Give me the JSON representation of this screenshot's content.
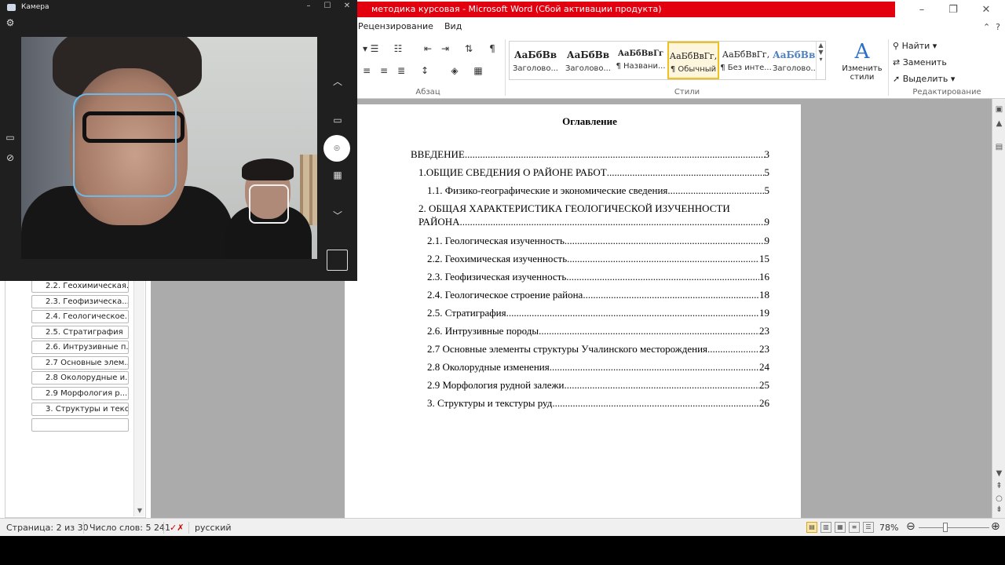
{
  "word": {
    "title": "методика курсовая  -  Microsoft Word (Сбой активации продукта)",
    "window_controls": [
      "–",
      "❐",
      "✕"
    ],
    "ribbon_tabs": [
      "Рецензирование",
      "Вид"
    ],
    "groups": {
      "paragraph": "Абзац",
      "styles": "Стили",
      "editing": "Редактирование"
    },
    "styles": [
      {
        "preview": "АаБбВв",
        "name": "Заголово..."
      },
      {
        "preview": "АаБбВв",
        "name": "Заголово..."
      },
      {
        "preview": "АаБбВвГг",
        "name": "¶ Названи..."
      },
      {
        "preview": "АаБбВвГг,",
        "name": "¶ Обычный"
      },
      {
        "preview": "АаБбВвГг,",
        "name": "¶ Без инте..."
      },
      {
        "preview": "АаБбВвI",
        "name": "Заголово..."
      }
    ],
    "change_styles": "Изменить стили",
    "editing": {
      "find": "Найти",
      "replace": "Заменить",
      "select": "Выделить"
    }
  },
  "nav_pane": {
    "items": [
      "2.2. Геохимическая...",
      "2.3. Геофизическа...",
      "2.4. Геологическое...",
      "2.5. Стратиграфия",
      "2.6. Интрузивные п...",
      "2.7 Основные элем...",
      "2.8 Околорудные и...",
      "2.9 Морфология р...",
      "3. Структуры и текс...",
      ""
    ]
  },
  "document": {
    "toc_title": "Оглавление",
    "toc": [
      {
        "text": "ВВЕДЕНИЕ",
        "page": "3"
      },
      {
        "text": "1.ОБЩИЕ СВЕДЕНИЯ О РАЙОНЕ РАБОТ",
        "page": "5"
      },
      {
        "text": "1.1. Физико-географические и экономические сведения",
        "page": "5"
      },
      {
        "text": "2. ОБЩАЯ ХАРАКТЕРИСТИКА ГЕОЛОГИЧЕСКОЙ ИЗУЧЕННОСТИ",
        "page": ""
      },
      {
        "text": "РАЙОНА",
        "page": "9"
      },
      {
        "text": "2.1. Геологическая изученность",
        "page": "9"
      },
      {
        "text": "2.2. Геохимическая изученность",
        "page": "15"
      },
      {
        "text": "2.3. Геофизическая изученность",
        "page": "16"
      },
      {
        "text": "2.4. Геологическое строение района",
        "page": "18"
      },
      {
        "text": "2.5. Стратиграфия",
        "page": "19"
      },
      {
        "text": "2.6. Интрузивные породы",
        "page": "23"
      },
      {
        "text": "2.7 Основные элементы структуры Учалинского месторождения",
        "page": "23"
      },
      {
        "text": "2.8 Околорудные изменения",
        "page": "24"
      },
      {
        "text": "2.9 Морфология рудной залежи",
        "page": "25"
      },
      {
        "text": "3. Структуры и текстуры руд",
        "page": "26"
      }
    ]
  },
  "status_bar": {
    "page": "Страница: 2 из 30",
    "words": "Число слов: 5 241",
    "language": "русский",
    "zoom": "78%",
    "zoom_value": 0.78
  },
  "camera": {
    "title": "Камера"
  }
}
